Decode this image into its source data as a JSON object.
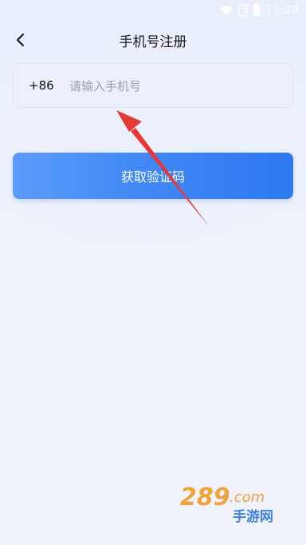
{
  "status_bar": {
    "time": "11:28",
    "icons": [
      "wifi-icon",
      "rotate-icon",
      "battery-icon"
    ]
  },
  "header": {
    "back_icon": "chevron-left-icon",
    "title": "手机号注册"
  },
  "phone_field": {
    "country_code": "+86",
    "placeholder": "请输入手机号",
    "value": ""
  },
  "get_code_button": {
    "label": "获取验证码"
  },
  "annotation": {
    "arrow_color": "#e53935"
  },
  "watermark": {
    "text_brand": "289.com",
    "text_cn": "手游网"
  },
  "colors": {
    "accent": "#3f87f5",
    "background": "#eef2fb"
  }
}
